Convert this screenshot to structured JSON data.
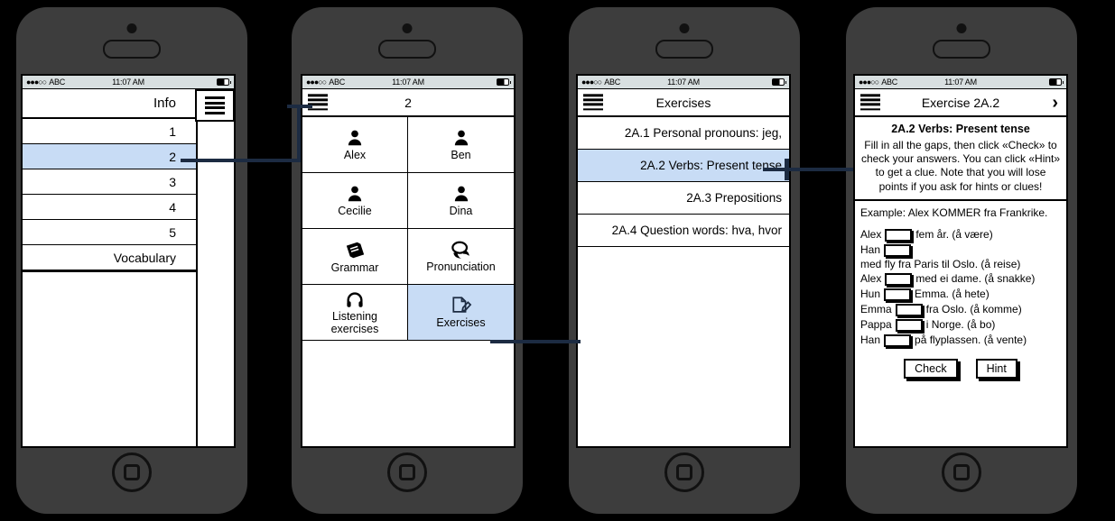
{
  "statusbar": {
    "carrier": "ABC",
    "signal_dots": "●●●○○",
    "time": "11:07 AM"
  },
  "screen1": {
    "title": "Info",
    "menu_icon": "hamburger-icon",
    "items": [
      "1",
      "2",
      "3",
      "4",
      "5",
      "Vocabulary"
    ],
    "selected": "2",
    "highlight_color": "#c8dcf5"
  },
  "screen2": {
    "title": "2",
    "menu_icon": "hamburger-icon",
    "tiles": [
      {
        "label": "Alex",
        "icon": "person-icon"
      },
      {
        "label": "Ben",
        "icon": "person-icon"
      },
      {
        "label": "Cecilie",
        "icon": "person-icon"
      },
      {
        "label": "Dina",
        "icon": "person-icon"
      },
      {
        "label": "Grammar",
        "icon": "book-icon"
      },
      {
        "label": "Pronunciation",
        "icon": "speech-bubble-icon"
      },
      {
        "label": "Listening\nexercises",
        "icon": "headphones-icon"
      },
      {
        "label": "Exercises",
        "icon": "document-pencil-icon"
      }
    ],
    "selected": "Exercises"
  },
  "screen3": {
    "title": "Exercises",
    "menu_icon": "hamburger-icon",
    "items": [
      "2A.1 Personal pronouns: jeg,",
      "2A.2 Verbs: Present tense",
      "2A.3 Prepositions",
      "2A.4 Question words: hva, hvor"
    ],
    "selected": "2A.2 Verbs: Present tense"
  },
  "screen4": {
    "title": "Exercise 2A.2",
    "menu_icon": "hamburger-icon",
    "next_icon": "chevron-right-icon",
    "heading": "2A.2 Verbs: Present tense",
    "instructions": "Fill in all the gaps, then click «Check» to check your answers. You can click «Hint» to get a clue. Note that you will lose points if you ask for hints or clues!",
    "example": "Example: Alex KOMMER fra Frankrike.",
    "gaps": [
      {
        "before": "Alex",
        "after": "fem år. (å være)",
        "value": ""
      },
      {
        "before": "Han",
        "after": "med fly fra Paris til Oslo. (å reise)",
        "value": ""
      },
      {
        "before": "Alex",
        "after": "med ei dame. (å snakke)",
        "value": ""
      },
      {
        "before": "Hun",
        "after": "Emma. (å hete)",
        "value": ""
      },
      {
        "before": "Emma",
        "after": "fra Oslo. (å komme)",
        "value": ""
      },
      {
        "before": "Pappa",
        "after": "i Norge. (å bo)",
        "value": ""
      },
      {
        "before": "Han",
        "after": "på flyplassen. (å vente)",
        "value": ""
      }
    ],
    "check_label": "Check",
    "hint_label": "Hint"
  }
}
